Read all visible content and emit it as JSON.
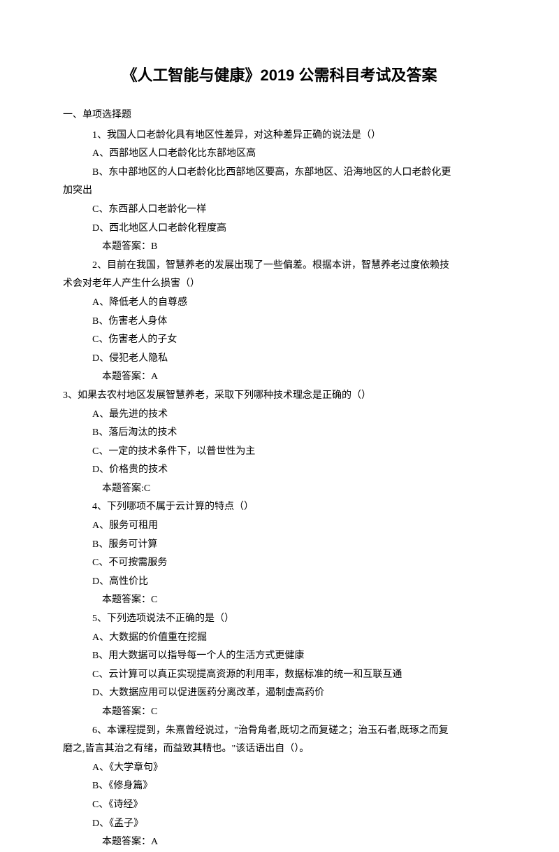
{
  "title": "《人工智能与健康》2019 公需科目考试及答案",
  "section": "一、单项选择题",
  "questions": [
    {
      "num": "1、",
      "text": "我国人口老龄化具有地区性差异，对这种差异正确的说法是（）",
      "options": [
        "A、西部地区人口老龄化比东部地区高",
        "B、东中部地区的人口老龄化比西部地区要高，东部地区、沿海地区的人口老龄化更",
        "C、东西部人口老龄化一样",
        "D、西北地区人口老龄化程度高"
      ],
      "continuation": "加突出",
      "answer": "本题答案：B"
    },
    {
      "num": "2、",
      "text": "目前在我国，智慧养老的发展出现了一些偏差。根据本讲，智慧养老过度依赖技",
      "continuation": "术会对老年人产生什么损害（）",
      "options": [
        "A、降低老人的自尊感",
        "B、伤害老人身体",
        "C、伤害老人的子女",
        "D、侵犯老人隐私"
      ],
      "answer": "本题答案：A"
    },
    {
      "num": "3、",
      "text": "如果去农村地区发展智慧养老，采取下列哪种技术理念是正确的（）",
      "noIndent": true,
      "options": [
        "A、最先进的技术",
        "B、落后淘汰的技术",
        "C、一定的技术条件下，以普世性为主",
        "D、价格贵的技术"
      ],
      "answer": "本题答案:C"
    },
    {
      "num": "4、",
      "text": "下列哪项不属于云计算的特点（）",
      "options": [
        "A、服务可租用",
        "B、服务可计算",
        "C、不可按需服务",
        "D、高性价比"
      ],
      "answer": "本题答案：C"
    },
    {
      "num": "5、",
      "text": "下列选项说法不正确的是（）",
      "options": [
        "A、大数据的价值重在挖掘",
        "B、用大数据可以指导每一个人的生活方式更健康",
        "C、云计算可以真正实现提高资源的利用率，数据标准的统一和互联互通",
        "D、大数据应用可以促进医药分离改革，遏制虚高药价"
      ],
      "answer": "本题答案：C"
    },
    {
      "num": "6、",
      "text": "本课程提到，朱熹曾经说过，\"治骨角者,既切之而复磋之；治玉石者,既琢之而复",
      "continuation": "磨之,皆言其治之有绪，而益致其精也。\"该话语出自（）。",
      "options": [
        "A、《大学章句》",
        "B、《修身篇》",
        "C、《诗经》",
        "D、《孟子》"
      ],
      "answer": "本题答案：A"
    }
  ]
}
